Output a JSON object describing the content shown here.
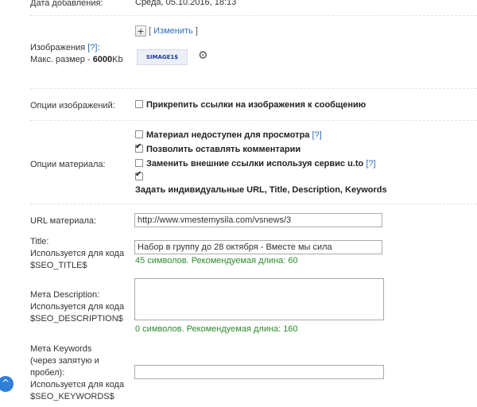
{
  "added": {
    "label": "Дата добавления:",
    "value": "Среда, 05.10.2016, 18:13"
  },
  "images": {
    "label": "Изображения",
    "help": "[?]",
    "colon": ":",
    "max_size_prefix": "Макс. размер - ",
    "max_size_value": "6000",
    "max_size_unit": "Kb",
    "plus": "+",
    "change_open": "[",
    "change_link": "Изменить",
    "change_close": "]",
    "thumb_text": "SIMAGE1$",
    "gear_icon": "gear-icon"
  },
  "image_options": {
    "label": "Опции изображений:",
    "attach": {
      "label": "Прикрепить ссылки на изображения к сообщению",
      "checked": false
    }
  },
  "material_options": {
    "label": "Опции материала:",
    "items": [
      {
        "label": "Материал недоступен для просмотра",
        "help": "[?]",
        "checked": false
      },
      {
        "label": "Позволить оставлять комментарии",
        "help": "",
        "checked": true
      },
      {
        "label": "Заменить внешние ссылки используя сервис u.to",
        "help": "[?]",
        "checked": false
      },
      {
        "label": "Задать индивидуальные URL, Title, Description, Keywords",
        "help": "",
        "checked": true
      }
    ]
  },
  "url": {
    "label": "URL материала:",
    "value": "http://www.vmestemysila.com/vsnews/3"
  },
  "title": {
    "label": "Title:",
    "usage": "Используется для кода",
    "code": "$SEO_TITLE$",
    "value": "Набор в группу до 28 октября - Вместе мы сила",
    "hint": "45 символов. Рекомендуемая длина: 60"
  },
  "description": {
    "label": "Мета Description:",
    "usage": "Используется для кода",
    "code": "$SEO_DESCRIPTION$",
    "value": "",
    "hint": "0 символов. Рекомендуемая длина: 160"
  },
  "keywords": {
    "label": "Мета Keywords",
    "note1": "(через запятую и",
    "note2": "пробел):",
    "usage": "Используется для кода",
    "code": "$SEO_KEYWORDS$",
    "value": ""
  },
  "scroll_top": {
    "glyph": "^",
    "icon": "chevron-up-icon"
  },
  "colors": {
    "link": "#2a6ebb",
    "hint": "#2e8b2e",
    "scroll_button": "#2f7fd6"
  }
}
